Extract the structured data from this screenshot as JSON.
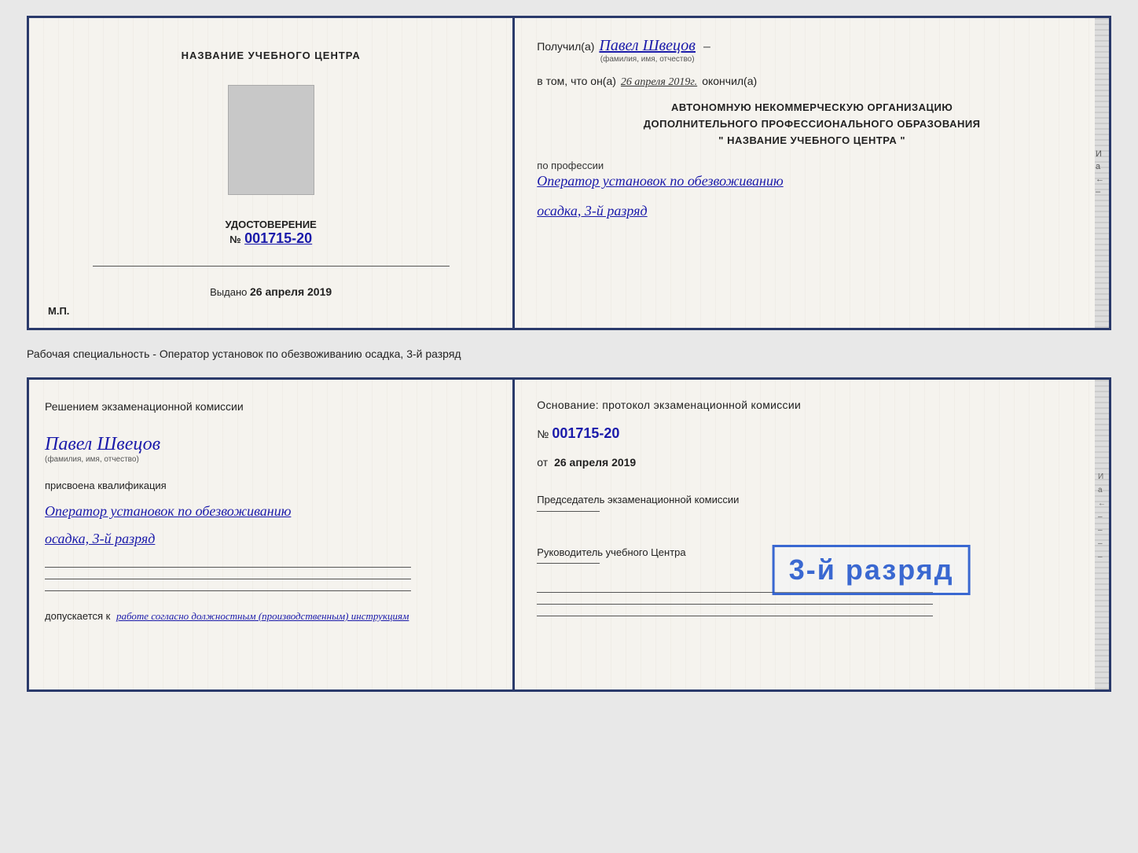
{
  "top_document": {
    "left": {
      "center_title": "НАЗВАНИЕ УЧЕБНОГО ЦЕНТРА",
      "cert_label": "УДОСТОВЕРЕНИЕ",
      "cert_number_prefix": "№",
      "cert_number": "001715-20",
      "issued_prefix": "Выдано",
      "issued_date": "26 апреля 2019",
      "mp_label": "М.П."
    },
    "right": {
      "recipient_prefix": "Получил(а)",
      "recipient_name": "Павел Швецов",
      "recipient_sublabel": "(фамилия, имя, отчество)",
      "recipient_dash": "–",
      "confirm_prefix": "в том, что он(а)",
      "confirm_date": "26 апреля 2019г.",
      "confirm_finished": "окончил(а)",
      "org_line1": "АВТОНОМНУЮ НЕКОММЕРЧЕСКУЮ ОРГАНИЗАЦИЮ",
      "org_line2": "ДОПОЛНИТЕЛЬНОГО ПРОФЕССИОНАЛЬНОГО ОБРАЗОВАНИЯ",
      "org_line3": "\"  НАЗВАНИЕ УЧЕБНОГО ЦЕНТРА  \"",
      "profession_label": "по профессии",
      "profession_name": "Оператор установок по обезвоживанию",
      "rank_name": "осадка, 3-й разряд",
      "side_chars": [
        "И",
        "а",
        "←",
        "–"
      ]
    }
  },
  "between_text": "Рабочая специальность - Оператор установок по обезвоживанию осадка, 3-й разряд",
  "bottom_document": {
    "left": {
      "decision_title": "Решением экзаменационной комиссии",
      "person_name": "Павел Швецов",
      "person_sublabel": "(фамилия, имя, отчество)",
      "assigned_label": "присвоена квалификация",
      "qualification_name1": "Оператор установок по обезвоживанию",
      "qualification_name2": "осадка, 3-й разряд",
      "allowed_prefix": "допускается к",
      "allowed_value": "работе согласно должностным (производственным) инструкциям",
      "lines_count": 4
    },
    "right": {
      "basis_title": "Основание: протокол экзаменационной комиссии",
      "basis_number_prefix": "№",
      "basis_number": "001715-20",
      "basis_date_prefix": "от",
      "basis_date": "26 апреля 2019",
      "chairman_title": "Председатель экзаменационной комиссии",
      "director_title": "Руководитель учебного Центра",
      "side_chars": [
        "И",
        "а",
        "←",
        "–",
        "–",
        "–",
        "–"
      ]
    },
    "stamp": {
      "text": "3-й разряд",
      "color": "#1a50cc"
    }
  }
}
